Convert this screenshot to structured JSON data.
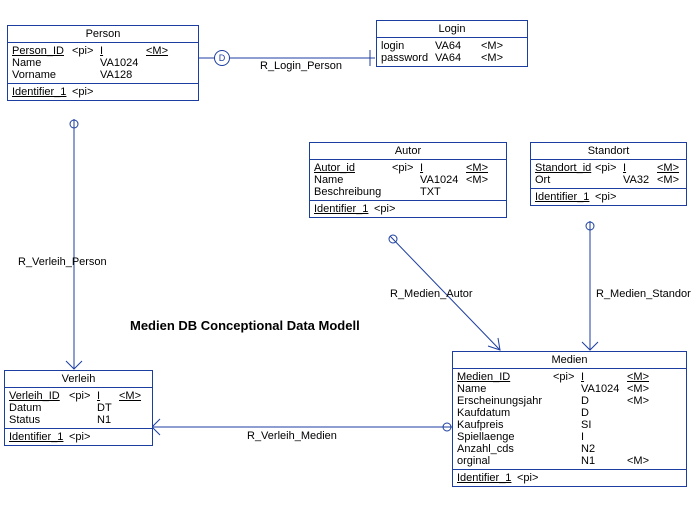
{
  "title": "Medien DB Conceptional Data Modell",
  "entities": {
    "person": {
      "name": "Person",
      "attrs": [
        {
          "name": "Person_ID",
          "pi": "<pi>",
          "type": "I",
          "m": "<M>",
          "u": true
        },
        {
          "name": "Name",
          "pi": "",
          "type": "VA1024",
          "m": ""
        },
        {
          "name": "Vorname",
          "pi": "",
          "type": "VA128",
          "m": ""
        }
      ],
      "identifier": {
        "name": "Identifier_1",
        "pi": "<pi>"
      }
    },
    "login": {
      "name": "Login",
      "attrs": [
        {
          "name": "login",
          "pi": "",
          "type": "VA64",
          "m": "<M>"
        },
        {
          "name": "password",
          "pi": "",
          "type": "VA64",
          "m": "<M>"
        }
      ]
    },
    "autor": {
      "name": "Autor",
      "attrs": [
        {
          "name": "Autor_id",
          "pi": "<pi>",
          "type": "I",
          "m": "<M>",
          "u": true
        },
        {
          "name": "Name",
          "pi": "",
          "type": "VA1024",
          "m": "<M>"
        },
        {
          "name": "Beschreibung",
          "pi": "",
          "type": "TXT",
          "m": ""
        }
      ],
      "identifier": {
        "name": "Identifier_1",
        "pi": "<pi>"
      }
    },
    "standort": {
      "name": "Standort",
      "attrs": [
        {
          "name": "Standort_id",
          "pi": "<pi>",
          "type": "I",
          "m": "<M>",
          "u": true
        },
        {
          "name": "Ort",
          "pi": "",
          "type": "VA32",
          "m": "<M>"
        }
      ],
      "identifier": {
        "name": "Identifier_1",
        "pi": "<pi>"
      }
    },
    "verleih": {
      "name": "Verleih",
      "attrs": [
        {
          "name": "Verleih_ID",
          "pi": "<pi>",
          "type": "I",
          "m": "<M>",
          "u": true
        },
        {
          "name": "Datum",
          "pi": "",
          "type": "DT",
          "m": ""
        },
        {
          "name": "Status",
          "pi": "",
          "type": "N1",
          "m": ""
        }
      ],
      "identifier": {
        "name": "Identifier_1",
        "pi": "<pi>"
      }
    },
    "medien": {
      "name": "Medien",
      "attrs": [
        {
          "name": "Medien_ID",
          "pi": "<pi>",
          "type": "I",
          "m": "<M>",
          "u": true
        },
        {
          "name": "Name",
          "pi": "",
          "type": "VA1024",
          "m": "<M>"
        },
        {
          "name": "Erscheinungsjahr",
          "pi": "",
          "type": "D",
          "m": "<M>"
        },
        {
          "name": "Kaufdatum",
          "pi": "",
          "type": "D",
          "m": ""
        },
        {
          "name": "Kaufpreis",
          "pi": "",
          "type": "SI",
          "m": ""
        },
        {
          "name": "Spiellaenge",
          "pi": "",
          "type": "I",
          "m": ""
        },
        {
          "name": "Anzahl_cds",
          "pi": "",
          "type": "N2",
          "m": ""
        },
        {
          "name": "orginal",
          "pi": "",
          "type": "N1",
          "m": "<M>"
        }
      ],
      "identifier": {
        "name": "Identifier_1",
        "pi": "<pi>"
      }
    }
  },
  "relationships": {
    "login_person": "R_Login_Person",
    "verleih_person": "R_Verleih_Person",
    "verleih_medien": "R_Verleih_Medien",
    "medien_autor": "R_Medien_Autor",
    "medien_standort": "R_Medien_Standort"
  },
  "marker_d": "D"
}
